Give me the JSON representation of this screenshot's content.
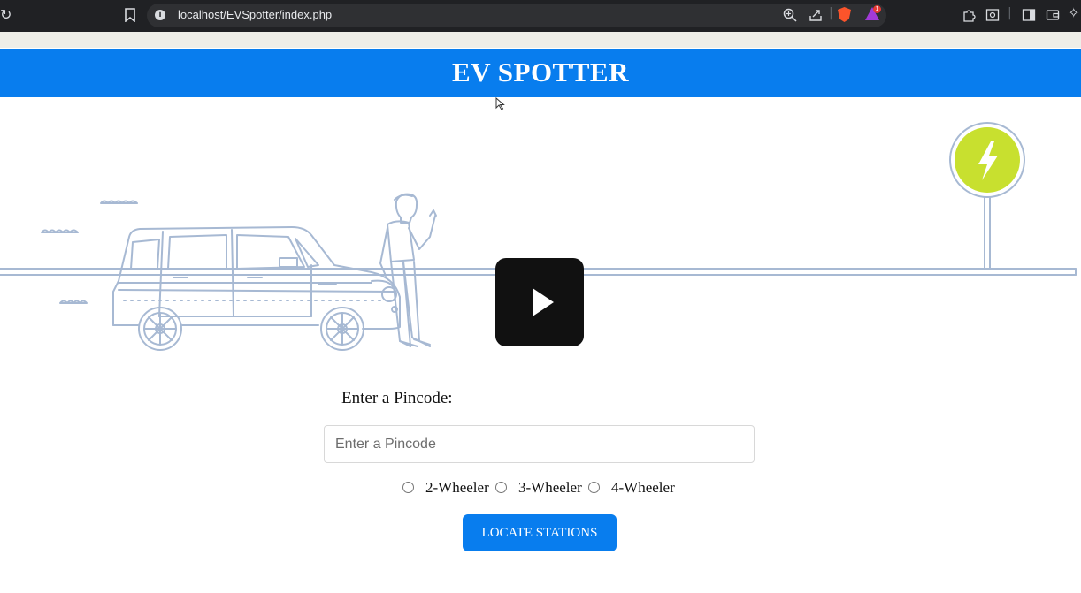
{
  "browser": {
    "url": "localhost/EVSpotter/index.php",
    "rewards_count": "1",
    "icons": [
      "reload-icon",
      "bookmark-icon",
      "info-icon",
      "zoom-icon",
      "share-icon",
      "brave-shield-icon",
      "brave-rewards-icon",
      "extensions-icon",
      "reading-list-icon",
      "sidebar-icon",
      "wallet-icon",
      "leo-icon"
    ]
  },
  "header": {
    "title": "EV SPOTTER",
    "bg_color": "#087dee"
  },
  "hero": {
    "charger_color": "#c8e02f"
  },
  "form": {
    "pincode_label": "Enter a Pincode:",
    "pincode_placeholder": "Enter a Pincode",
    "pincode_value": "",
    "vehicle_options": [
      "2-Wheeler",
      "3-Wheeler",
      "4-Wheeler"
    ],
    "submit_label": "LOCATE STATIONS"
  }
}
